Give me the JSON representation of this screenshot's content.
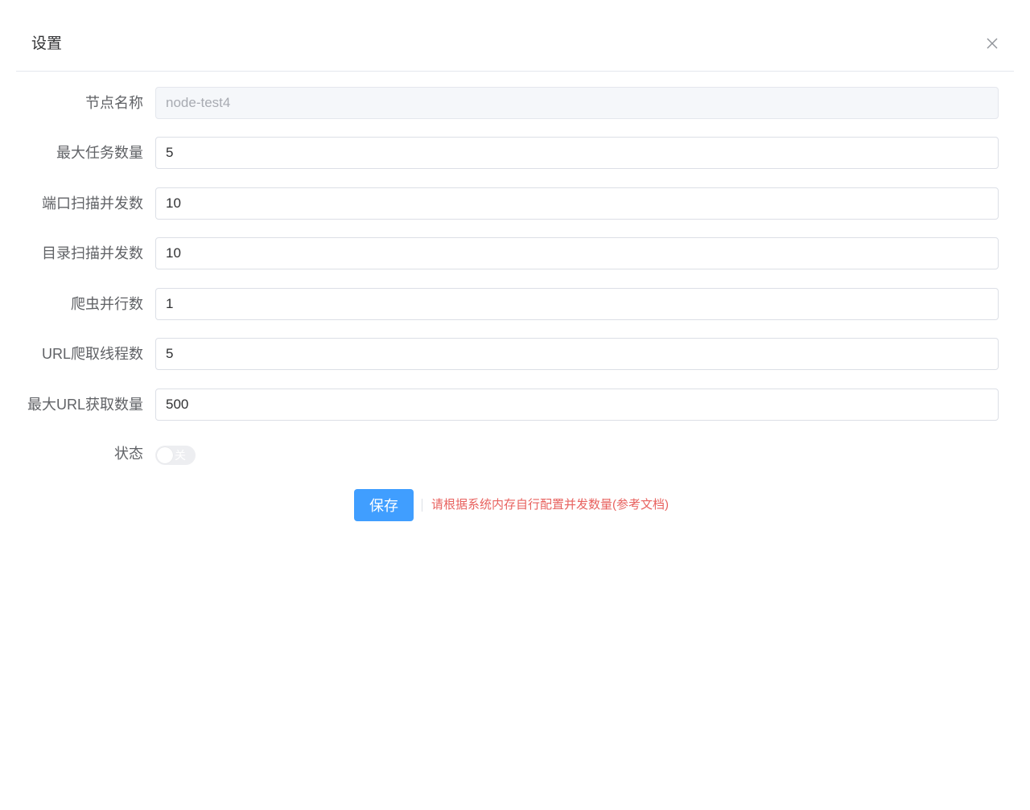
{
  "dialog": {
    "title": "设置",
    "close_icon": "close-icon"
  },
  "form": {
    "node_name": {
      "label": "节点名称",
      "value": "node-test4",
      "disabled": true
    },
    "max_tasks": {
      "label": "最大任务数量",
      "value": "5"
    },
    "port_scan_concurrency": {
      "label": "端口扫描并发数",
      "value": "10"
    },
    "dir_scan_concurrency": {
      "label": "目录扫描并发数",
      "value": "10"
    },
    "crawler_parallel": {
      "label": "爬虫并行数",
      "value": "1"
    },
    "url_crawl_threads": {
      "label": "URL爬取线程数",
      "value": "5"
    },
    "max_url_fetch": {
      "label": "最大URL获取数量",
      "value": "500"
    },
    "status": {
      "label": "状态",
      "switch_text": "关",
      "on": false
    }
  },
  "actions": {
    "save_label": "保存",
    "hint_text": "请根据系统内存自行配置并发数量(参考文档)"
  },
  "colors": {
    "primary": "#409eff",
    "hint": "#e8625f",
    "label": "#606266",
    "border": "#dcdfe6"
  }
}
